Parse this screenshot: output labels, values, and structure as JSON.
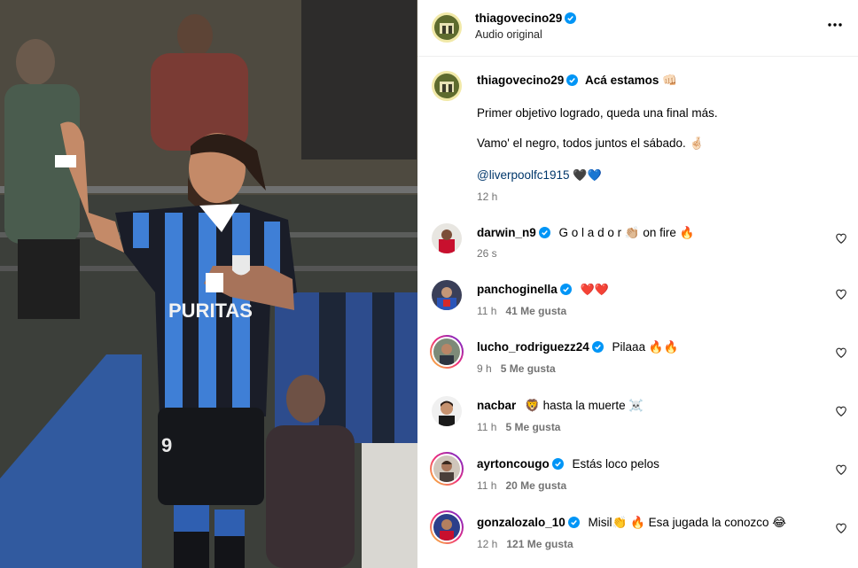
{
  "header": {
    "username": "thiagovecino29",
    "subtitle": "Audio original",
    "more_label": "•••"
  },
  "caption": {
    "username": "thiagovecino29",
    "headline": "Acá estamos 👊🏻",
    "line1": "Primer objetivo logrado, queda una final más.",
    "line2": "Vamo' el negro, todos juntos el sábado. 🤞🏻",
    "mention": "@liverpoolfc1915",
    "hearts": "🖤💙",
    "time": "12 h"
  },
  "comments": [
    {
      "username": "darwin_n9",
      "text": "G o l a d o r 👏🏼 on fire 🔥",
      "time": "26 s",
      "likes": "",
      "verified": true
    },
    {
      "username": "panchoginella",
      "text": "❤️❤️",
      "time": "11 h",
      "likes": "41 Me gusta",
      "verified": true
    },
    {
      "username": "lucho_rodriguezz24",
      "text": "Pilaaa 🔥🔥",
      "time": "9 h",
      "likes": "5 Me gusta",
      "verified": true
    },
    {
      "username": "nacbar",
      "text": "🦁 hasta la muerte ☠️",
      "time": "11 h",
      "likes": "5 Me gusta",
      "verified": false
    },
    {
      "username": "ayrtoncougo",
      "text": "Estás loco pelos",
      "time": "11 h",
      "likes": "20 Me gusta",
      "verified": true
    },
    {
      "username": "gonzalozalo_10",
      "text": "Misil👏 🔥 Esa jugada la conozco 😂",
      "time": "12 h",
      "likes": "121 Me gusta",
      "verified": true
    }
  ],
  "photo": {
    "jersey_text": "PURITAS",
    "number": "9"
  },
  "colors": {
    "verified": "#0095f6",
    "meta": "#737373",
    "mention": "#00376b",
    "divider": "#efefef"
  }
}
